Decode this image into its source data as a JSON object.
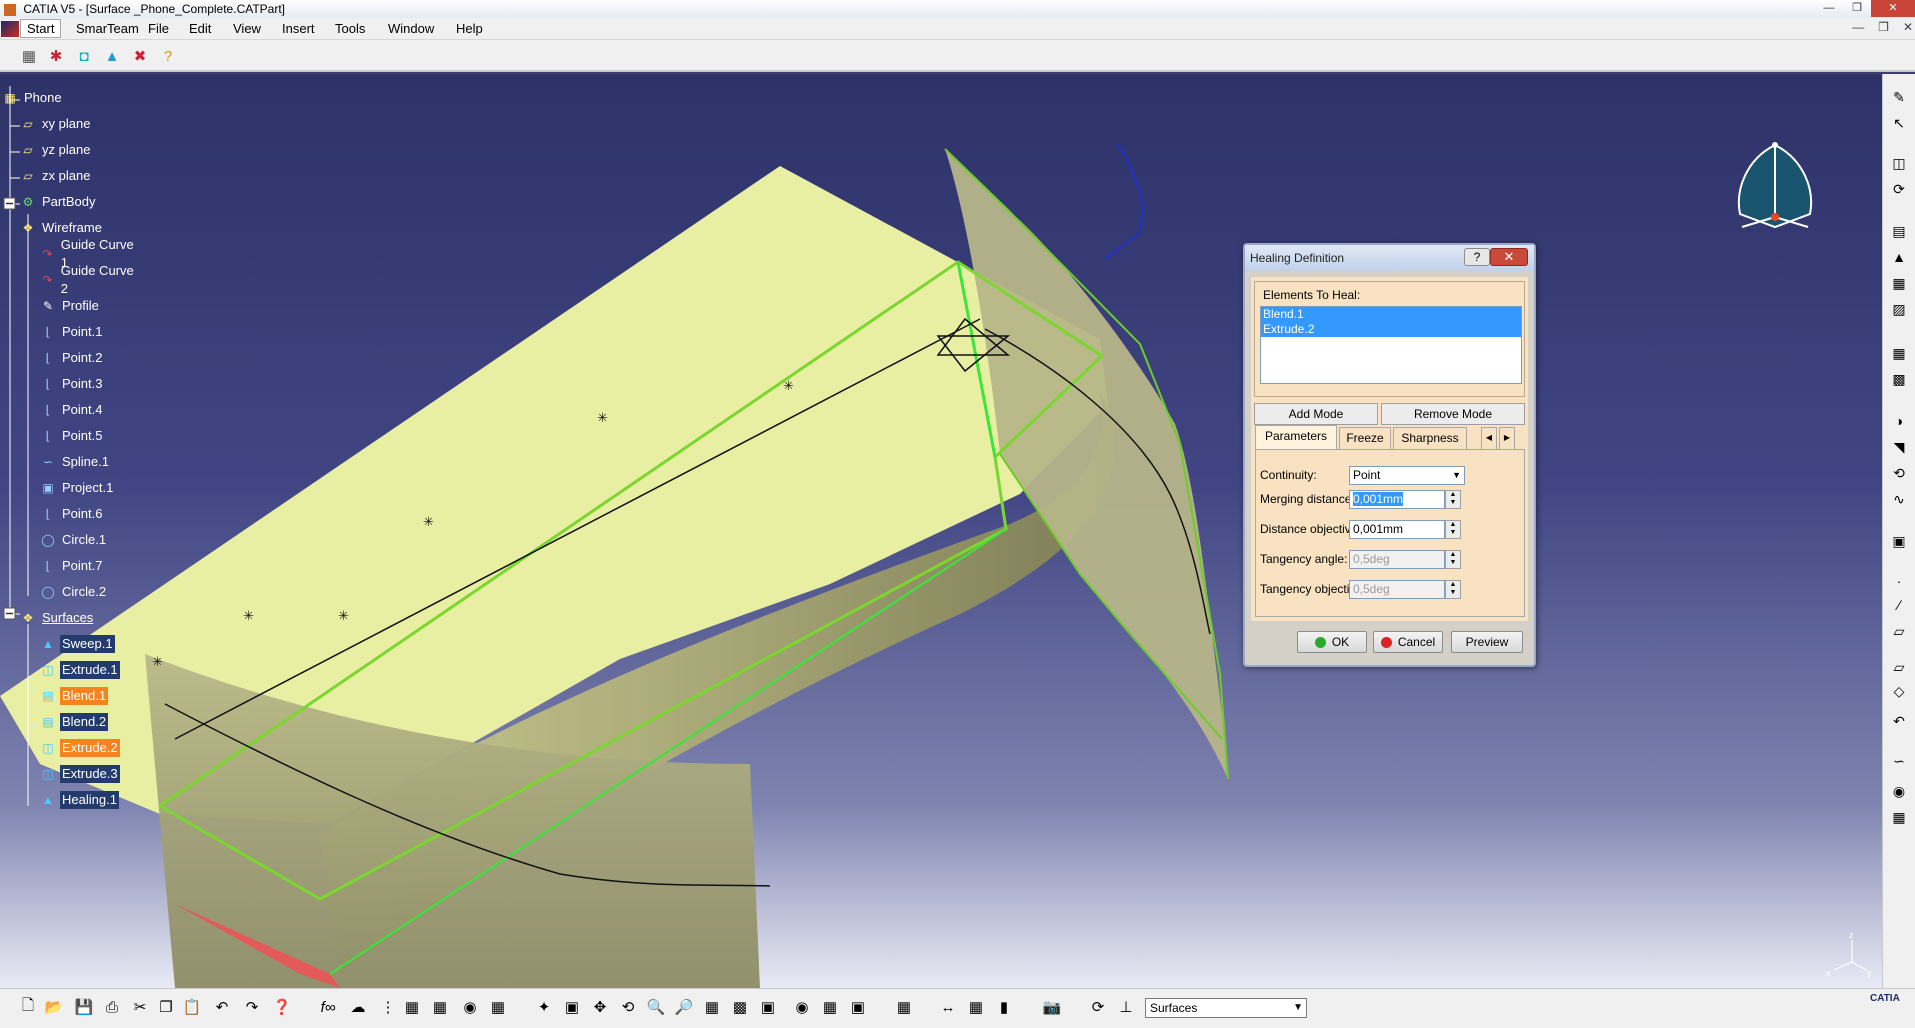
{
  "window": {
    "title": "CATIA V5 - [Surface _Phone_Complete.CATPart]"
  },
  "menu": {
    "items": [
      "Start",
      "SmarTeam",
      "File",
      "Edit",
      "View",
      "Insert",
      "Tools",
      "Window",
      "Help"
    ]
  },
  "tree": {
    "nodes": [
      {
        "label": "Phone",
        "icon": "part-icon"
      },
      {
        "label": "xy plane",
        "icon": "plane-icon"
      },
      {
        "label": "yz plane",
        "icon": "plane-icon"
      },
      {
        "label": "zx plane",
        "icon": "plane-icon"
      },
      {
        "label": "PartBody",
        "icon": "gear-icon"
      },
      {
        "label": "Wireframe",
        "icon": "geometrical-set-icon"
      },
      {
        "label": "Guide Curve 1",
        "icon": "curve-icon"
      },
      {
        "label": "Guide Curve 2",
        "icon": "curve-icon"
      },
      {
        "label": "Profile",
        "icon": "sketch-icon"
      },
      {
        "label": "Point.1",
        "icon": "point-icon"
      },
      {
        "label": "Point.2",
        "icon": "point-icon"
      },
      {
        "label": "Point.3",
        "icon": "point-icon"
      },
      {
        "label": "Point.4",
        "icon": "point-icon"
      },
      {
        "label": "Point.5",
        "icon": "point-icon"
      },
      {
        "label": "Spline.1",
        "icon": "spline-icon"
      },
      {
        "label": "Project.1",
        "icon": "project-icon"
      },
      {
        "label": "Point.6",
        "icon": "point-icon"
      },
      {
        "label": "Circle.1",
        "icon": "circle-icon"
      },
      {
        "label": "Point.7",
        "icon": "point-icon"
      },
      {
        "label": "Circle.2",
        "icon": "circle-icon"
      },
      {
        "label": "Surfaces",
        "icon": "geometrical-set-icon"
      },
      {
        "label": "Sweep.1",
        "icon": "sweep-icon"
      },
      {
        "label": "Extrude.1",
        "icon": "extrude-icon"
      },
      {
        "label": "Blend.1",
        "icon": "blend-icon"
      },
      {
        "label": "Blend.2",
        "icon": "blend-icon"
      },
      {
        "label": "Extrude.2",
        "icon": "extrude-icon"
      },
      {
        "label": "Extrude.3",
        "icon": "extrude-icon"
      },
      {
        "label": "Healing.1",
        "icon": "healing-icon"
      }
    ]
  },
  "dialog": {
    "title": "Healing Definition",
    "help": "?",
    "close": "✕",
    "elements_legend": "Elements To Heal:",
    "elements": [
      "Blend.1",
      "Extrude.2"
    ],
    "add_mode": "Add Mode",
    "remove_mode": "Remove Mode",
    "tabs": [
      "Parameters",
      "Freeze",
      "Sharpness"
    ],
    "continuity_label": "Continuity:",
    "continuity_value": "Point",
    "merging_label": "Merging distance:",
    "merging_value": "0,001mm",
    "distance_obj_label": "Distance objective:",
    "distance_obj_value": "0,001mm",
    "tangency_angle_label": "Tangency angle:",
    "tangency_angle_value": "0,5deg",
    "tangency_obj_label": "Tangency objective:",
    "tangency_obj_value": "0,5deg",
    "ok": "OK",
    "cancel": "Cancel",
    "preview": "Preview"
  },
  "workbench": {
    "value": "Surfaces"
  },
  "logo_text": "CATIA",
  "colors": {
    "viewport_top": "#2e3268",
    "surface_fill": "#e8efa2",
    "edge_green": "#39e639",
    "selection_orange": "#f5831f",
    "dialog_body": "#f8e2c2"
  }
}
